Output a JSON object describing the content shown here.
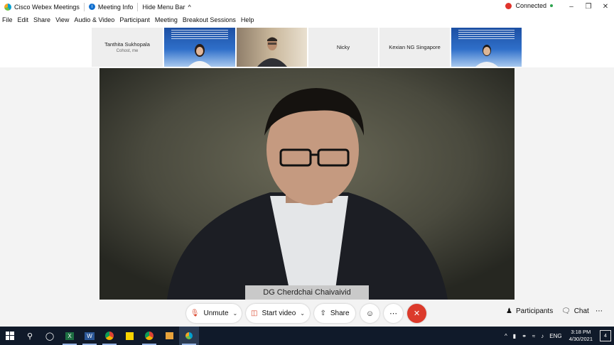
{
  "titlebar": {
    "app_title": "Cisco Webex Meetings",
    "meeting_info": "Meeting Info",
    "hide_menu_bar": "Hide Menu Bar",
    "status": "Connected"
  },
  "menu": [
    "File",
    "Edit",
    "Share",
    "View",
    "Audio & Video",
    "Participant",
    "Meeting",
    "Breakout Sessions",
    "Help"
  ],
  "participants_strip": [
    {
      "name": "Tanthita Sukhopala",
      "subtitle": "Cohost, me",
      "kind": "name-only"
    },
    {
      "name": "",
      "kind": "video-slide"
    },
    {
      "name": "",
      "kind": "video"
    },
    {
      "name": "Nicky",
      "kind": "name-only"
    },
    {
      "name": "Kexian NG Singapore",
      "kind": "name-only"
    },
    {
      "name": "",
      "kind": "video-slide"
    }
  ],
  "active_speaker": {
    "name": "DG Cherdchai Chaivaivid"
  },
  "controls": {
    "unmute": "Unmute",
    "start_video": "Start video",
    "share": "Share",
    "participants": "Participants",
    "chat": "Chat"
  },
  "taskbar": {
    "language": "ENG",
    "time": "3:18 PM",
    "date": "4/30/2021",
    "notifications": "4"
  },
  "colors": {
    "end_meeting": "#dc3a2b",
    "taskbar": "#101a2a",
    "connected_dot": "#2da44e"
  }
}
